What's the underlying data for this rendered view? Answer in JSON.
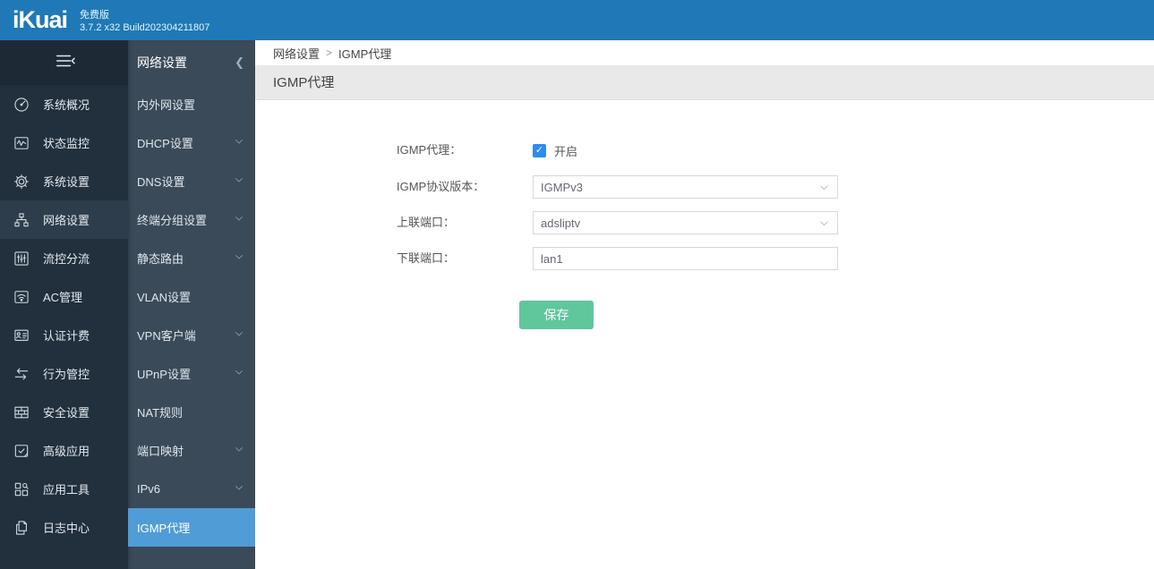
{
  "header": {
    "logo": "iKuai",
    "edition": "免费版",
    "version": "3.7.2 x32 Build202304211807"
  },
  "sidebar": {
    "items": [
      {
        "label": "系统概况",
        "icon": "gauge-icon"
      },
      {
        "label": "状态监控",
        "icon": "monitor-icon"
      },
      {
        "label": "系统设置",
        "icon": "gear-icon"
      },
      {
        "label": "网络设置",
        "icon": "network-icon",
        "active": true
      },
      {
        "label": "流控分流",
        "icon": "sliders-icon"
      },
      {
        "label": "AC管理",
        "icon": "wifi-icon"
      },
      {
        "label": "认证计费",
        "icon": "id-card-icon"
      },
      {
        "label": "行为管控",
        "icon": "swap-arrows-icon"
      },
      {
        "label": "安全设置",
        "icon": "brick-wall-icon"
      },
      {
        "label": "高级应用",
        "icon": "window-check-icon"
      },
      {
        "label": "应用工具",
        "icon": "grid-wrench-icon"
      },
      {
        "label": "日志中心",
        "icon": "documents-icon"
      }
    ]
  },
  "submenu": {
    "title": "网络设置",
    "items": [
      {
        "label": "内外网设置",
        "expandable": false
      },
      {
        "label": "DHCP设置",
        "expandable": true
      },
      {
        "label": "DNS设置",
        "expandable": true
      },
      {
        "label": "终端分组设置",
        "expandable": true
      },
      {
        "label": "静态路由",
        "expandable": true
      },
      {
        "label": "VLAN设置",
        "expandable": false
      },
      {
        "label": "VPN客户端",
        "expandable": true
      },
      {
        "label": "UPnP设置",
        "expandable": true
      },
      {
        "label": "NAT规则",
        "expandable": false
      },
      {
        "label": "端口映射",
        "expandable": true
      },
      {
        "label": "IPv6",
        "expandable": true
      },
      {
        "label": "IGMP代理",
        "expandable": false,
        "active": true
      }
    ]
  },
  "breadcrumb": {
    "parent": "网络设置",
    "separator": ">",
    "current": "IGMP代理"
  },
  "page": {
    "section_title": "IGMP代理"
  },
  "form": {
    "igmp_label": "IGMP代理：",
    "igmp_checked": true,
    "checkmark": "✓",
    "igmp_enabled_label": "开启",
    "version_label": "IGMP协议版本：",
    "version_value": "IGMPv3",
    "uplink_label": "上联端口：",
    "uplink_value": "adsliptv",
    "downlink_label": "下联端口：",
    "downlink_value": "lan1",
    "save_label": "保存"
  },
  "colors": {
    "topbar_blue": "#1f79b6",
    "sidebar_bg": "#22303e",
    "submenu_bg": "#3a4a59",
    "active_submenu_blue": "#509cd6",
    "checkbox_blue": "#2d8cf0",
    "save_green": "#5fc79b",
    "section_header_gray": "#e9e9e9"
  }
}
